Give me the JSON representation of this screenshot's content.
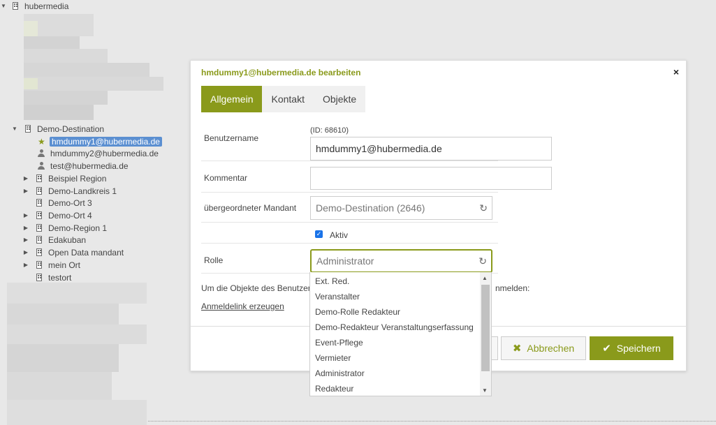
{
  "tree": {
    "root": "hubermedia",
    "destination": "Demo-Destination",
    "users": [
      "hmdummy1@hubermedia.de",
      "hmdummy2@hubermedia.de",
      "test@hubermedia.de"
    ],
    "items": [
      "Beispiel Region",
      "Demo-Landkreis 1",
      "Demo-Ort 3",
      "Demo-Ort 4",
      "Demo-Region 1",
      "Edakuban",
      "Open Data mandant",
      "mein Ort",
      "testort"
    ]
  },
  "modal": {
    "title": "hmdummy1@hubermedia.de bearbeiten",
    "close": "×",
    "tabs": [
      "Allgemein",
      "Kontakt",
      "Objekte"
    ],
    "labels": {
      "username": "Benutzername",
      "comment": "Kommentar",
      "parent": "übergeordneter Mandant",
      "role": "Rolle"
    },
    "id_text": "(ID: 68610)",
    "username_value": "hmdummy1@hubermedia.de",
    "comment_value": "",
    "parent_value": "Demo-Destination (2646)",
    "active_label": "Aktiv",
    "role_value": "Administrator",
    "info_text": "Um die Objekte des Benutzer",
    "info_text_end": "nmelden:",
    "login_link": "Anmeldelink erzeugen",
    "cancel_label": "Abbrechen",
    "save_label": "Speichern"
  },
  "dropdown_options": [
    "Ext. Red.",
    "Veranstalter",
    "Demo-Rolle Redakteur",
    "Demo-Redakteur Veranstaltungserfassung",
    "Event-Pflege",
    "Vermieter",
    "Administrator",
    "Redakteur"
  ],
  "colors": {
    "accent": "#8a9a1b",
    "selection": "#5b8fd1",
    "checkbox": "#1a73e8"
  }
}
